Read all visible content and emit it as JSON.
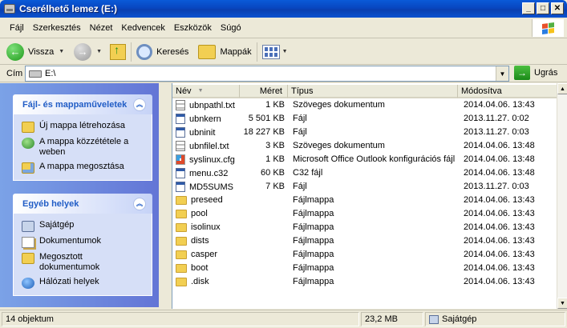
{
  "window": {
    "title": "Cserélhető lemez (E:)",
    "btn_min": "_",
    "btn_max": "□",
    "btn_close": "✕"
  },
  "menu": [
    "Fájl",
    "Szerkesztés",
    "Nézet",
    "Kedvencek",
    "Eszközök",
    "Súgó"
  ],
  "toolbar": {
    "back_label": "Vissza",
    "search_label": "Keresés",
    "folders_label": "Mappák"
  },
  "address": {
    "label": "Cím",
    "value": "E:\\",
    "go_label": "Ugrás"
  },
  "tasks_panel": {
    "title": "Fájl- és mappaműveletek",
    "items": [
      "Új mappa létrehozása",
      "A mappa közzététele a weben",
      "A mappa megosztása"
    ]
  },
  "places_panel": {
    "title": "Egyéb helyek",
    "items": [
      "Sajátgép",
      "Dokumentumok",
      "Megosztott dokumentumok",
      "Hálózati helyek"
    ]
  },
  "columns": {
    "name": "Név",
    "size": "Méret",
    "type": "Típus",
    "modified": "Módosítva"
  },
  "files": [
    {
      "icon": "doc",
      "name": "ubnpathl.txt",
      "size": "1 KB",
      "type": "Szöveges dokumentum",
      "modified": "2014.04.06. 13:43"
    },
    {
      "icon": "app",
      "name": "ubnkern",
      "size": "5 501 KB",
      "type": "Fájl",
      "modified": "2013.11.27. 0:02"
    },
    {
      "icon": "app",
      "name": "ubninit",
      "size": "18 227 KB",
      "type": "Fájl",
      "modified": "2013.11.27. 0:03"
    },
    {
      "icon": "doc",
      "name": "ubnfilel.txt",
      "size": "3 KB",
      "type": "Szöveges dokumentum",
      "modified": "2014.04.06. 13:48"
    },
    {
      "icon": "cfg",
      "name": "syslinux.cfg",
      "size": "1 KB",
      "type": "Microsoft Office Outlook konfigurációs fájl",
      "modified": "2014.04.06. 13:48"
    },
    {
      "icon": "app",
      "name": "menu.c32",
      "size": "60 KB",
      "type": "C32 fájl",
      "modified": "2014.04.06. 13:48"
    },
    {
      "icon": "app",
      "name": "MD5SUMS",
      "size": "7 KB",
      "type": "Fájl",
      "modified": "2013.11.27. 0:03"
    },
    {
      "icon": "folder",
      "name": "preseed",
      "size": "",
      "type": "Fájlmappa",
      "modified": "2014.04.06. 13:43"
    },
    {
      "icon": "folder",
      "name": "pool",
      "size": "",
      "type": "Fájlmappa",
      "modified": "2014.04.06. 13:43"
    },
    {
      "icon": "folder",
      "name": "isolinux",
      "size": "",
      "type": "Fájlmappa",
      "modified": "2014.04.06. 13:43"
    },
    {
      "icon": "folder",
      "name": "dists",
      "size": "",
      "type": "Fájlmappa",
      "modified": "2014.04.06. 13:43"
    },
    {
      "icon": "folder",
      "name": "casper",
      "size": "",
      "type": "Fájlmappa",
      "modified": "2014.04.06. 13:43"
    },
    {
      "icon": "folder",
      "name": "boot",
      "size": "",
      "type": "Fájlmappa",
      "modified": "2014.04.06. 13:43"
    },
    {
      "icon": "folder",
      "name": ".disk",
      "size": "",
      "type": "Fájlmappa",
      "modified": "2014.04.06. 13:43"
    }
  ],
  "status": {
    "count": "14 objektum",
    "size": "23,2 MB",
    "location": "Sajátgép"
  },
  "colors": {
    "title_blue": "#0a4ad0",
    "task_pane_blue": "#6d8ee0",
    "link_blue": "#215dc6"
  }
}
